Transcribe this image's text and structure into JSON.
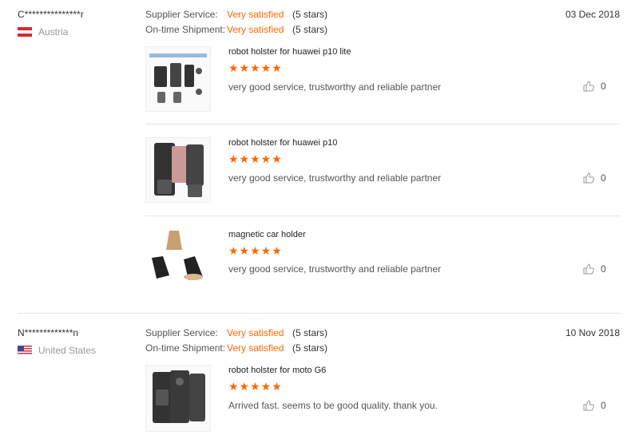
{
  "reviews": [
    {
      "buyer": "C***************r",
      "country": "Austria",
      "supplier_label": "Supplier Service:",
      "supplier_value": "Very satisfied",
      "supplier_stars": "(5 stars)",
      "shipment_label": "On-time Shipment:",
      "shipment_value": "Very satisfied",
      "shipment_stars": "(5 stars)",
      "date": "03 Dec 2018",
      "products": [
        {
          "name": "robot holster for huawei p10 lite",
          "stars": "★★★★★",
          "feedback": "very good service, trustworthy and reliable partner",
          "likes": "0"
        },
        {
          "name": "robot holster for huawei p10",
          "stars": "★★★★★",
          "feedback": "very good service, trustworthy and reliable partner",
          "likes": "0"
        },
        {
          "name": "magnetic car holder",
          "stars": "★★★★★",
          "feedback": "very good service, trustworthy and reliable partner",
          "likes": "0"
        }
      ]
    },
    {
      "buyer": "N*************n",
      "country": "United States",
      "supplier_label": "Supplier Service:",
      "supplier_value": "Very satisfied",
      "supplier_stars": "(5 stars)",
      "shipment_label": "On-time Shipment:",
      "shipment_value": "Very satisfied",
      "shipment_stars": "(5 stars)",
      "date": "10 Nov 2018",
      "products": [
        {
          "name": "robot holster for moto G6",
          "stars": "★★★★★",
          "feedback": "Arrived fast. seems to be good quality. thank you.",
          "likes": "0"
        }
      ]
    }
  ],
  "icons": {
    "like": "thumbs-up-icon",
    "austria_flag": "austria-flag-icon",
    "us_flag": "us-flag-icon"
  },
  "colors": {
    "accent": "#ff6600",
    "divider": "#e5e5e5"
  }
}
